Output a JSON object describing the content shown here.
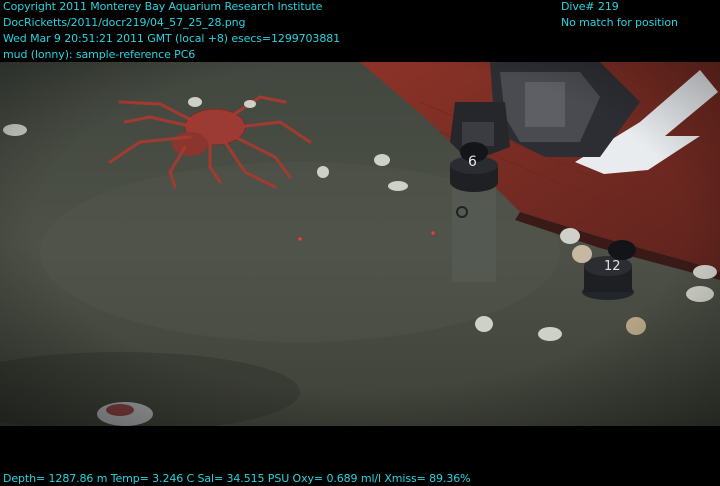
{
  "overlay": {
    "top_left": [
      "Copyright 2011 Monterey Bay Aquarium Research Institute",
      "DocRicketts/2011/docr219/04_57_25_28.png",
      "Wed Mar  9 20:51:21 2011 GMT (local +8)  esecs=1299703881",
      "mud (lonny): sample-reference PC6"
    ],
    "top_right": [
      "Dive# 219",
      "No match for position"
    ],
    "bottom": "Depth= 1287.86 m  Temp= 3.246 C  Sal= 34.515 PSU  Oxy= 0.689 ml/l  Xmiss= 89.36%"
  },
  "scene": {
    "markers": [
      "6",
      "12"
    ],
    "colors": {
      "seafloor": "#4a4e45",
      "seafloor_dark": "#33372f",
      "robot_arm": "#2b2b2f",
      "red_structure": "#7a2a22",
      "crab": "#a23a2e",
      "overlay_text": "#29d3df"
    }
  }
}
